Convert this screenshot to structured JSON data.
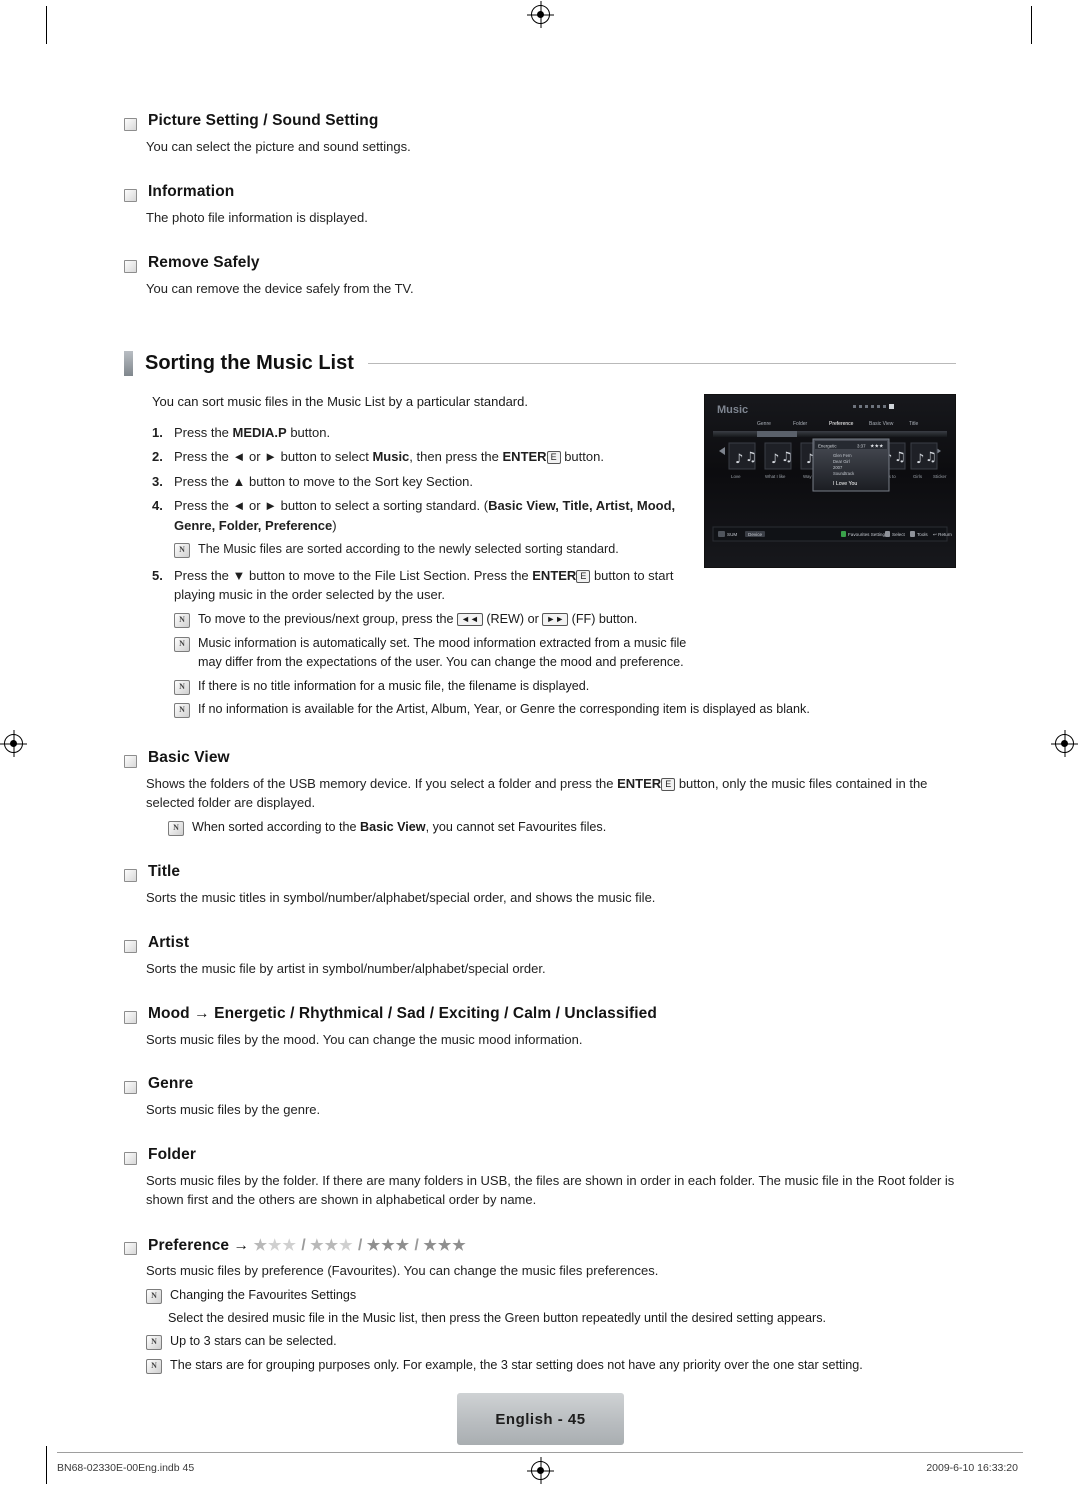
{
  "document": {
    "page_label": "English - 45",
    "footer_left": "BN68-02330E-00Eng.indb   45",
    "footer_right": "2009-6-10   16:33:20"
  },
  "top_sections": [
    {
      "title": "Picture Setting / Sound Setting",
      "body": "You can select the picture and sound settings."
    },
    {
      "title": "Information",
      "body": "The photo file information is displayed."
    },
    {
      "title": "Remove Safely",
      "body": "You can remove the device safely from the TV."
    }
  ],
  "section": {
    "heading": "Sorting the Music List",
    "intro": "You can sort music files in the Music List by a particular standard.",
    "steps": [
      {
        "num": "1.",
        "parts": [
          {
            "t": "Press the ",
            "b": false
          },
          {
            "t": "MEDIA.P",
            "b": true
          },
          {
            "t": " button.",
            "b": false
          }
        ]
      },
      {
        "num": "2.",
        "parts": [
          {
            "t": "Press the ◄ or ► button to select ",
            "b": false
          },
          {
            "t": "Music",
            "b": true
          },
          {
            "t": ", then press the ",
            "b": false
          },
          {
            "t": "ENTER",
            "b": true
          },
          {
            "t": "E",
            "b": false,
            "key": true
          },
          {
            "t": " button.",
            "b": false
          }
        ]
      },
      {
        "num": "3.",
        "parts": [
          {
            "t": "Press the ▲ button to move to the Sort key Section.",
            "b": false
          }
        ]
      },
      {
        "num": "4.",
        "parts": [
          {
            "t": "Press the ◄ or ► button to select a sorting standard. (",
            "b": false
          },
          {
            "t": "Basic View, Title, Artist, Mood, Genre, Folder, Preference",
            "b": true
          },
          {
            "t": ")",
            "b": false
          }
        ]
      },
      {
        "num": "5.",
        "parts": [
          {
            "t": "Press the ▼ button to move to the File List Section. Press the ",
            "b": false
          },
          {
            "t": "ENTER",
            "b": true
          },
          {
            "t": "E",
            "b": false,
            "key": true
          },
          {
            "t": " button to start playing music in the order selected by the user.",
            "b": false
          }
        ]
      }
    ],
    "note_after_step4": "The Music files are sorted according to the newly selected sorting standard.",
    "notes_after_step5": [
      "To move to the previous/next group, press the ◄◄ (REW) or ►► (FF) button.",
      "Music information is automatically set. The mood information extracted from a music file may differ from the expectations of the user. You can change the mood and preference.",
      "If there is no title information for a music file, the filename is displayed.",
      "If no information is available for the Artist, Album, Year, or Genre the corresponding item is displayed as blank."
    ]
  },
  "sort_options": [
    {
      "title": "Basic View",
      "body_parts": [
        {
          "t": "Shows the folders of the USB memory device. If you select a folder and press the ",
          "b": false
        },
        {
          "t": "ENTER",
          "b": true
        },
        {
          "t": "E",
          "b": false,
          "key": true
        },
        {
          "t": " button, only the music files contained in the selected folder are displayed.",
          "b": false
        }
      ],
      "note_parts": [
        {
          "t": "When sorted according to the ",
          "b": false
        },
        {
          "t": "Basic View",
          "b": true
        },
        {
          "t": ", you cannot set Favourites files.",
          "b": false
        }
      ]
    },
    {
      "title": "Title",
      "body": "Sorts the music titles in symbol/number/alphabet/special order, and shows the music file."
    },
    {
      "title": "Artist",
      "body": "Sorts the music file by artist in symbol/number/alphabet/special order."
    },
    {
      "title": "Mood → Energetic / Rhythmical / Sad / Exciting / Calm / Unclassified",
      "body": "Sorts music files by the mood. You can change the music mood information."
    },
    {
      "title": "Genre",
      "body": "Sorts music files by the genre."
    },
    {
      "title": "Folder",
      "body": "Sorts music files by the folder. If there are many folders in USB, the files are shown in order in each folder. The music file in the Root folder is shown first and the others are shown in alphabetical order by name."
    }
  ],
  "preference": {
    "title_prefix": "Preference →",
    "star_groups": [
      1,
      2,
      3,
      3
    ],
    "body": "Sorts music files by preference (Favourites). You can change the music files preferences.",
    "notes": [
      "Changing the Favourites Settings",
      "Up to 3 stars can be selected.",
      "The stars are for grouping purposes only. For example, the 3 star setting does not have any priority over the one star setting."
    ],
    "sub_note": "Select the desired music file in the Music list, then press the Green button repeatedly until the desired setting appears."
  },
  "tv_screenshot": {
    "app_title": "Music",
    "tabs": [
      "Genre",
      "Folder",
      "Preference",
      "Basic View",
      "Title"
    ],
    "now_playing": {
      "label": "Energetic",
      "time": "3:37",
      "title": "I Love You",
      "lines": [
        "Glen Fern",
        "Dear Girl",
        "2007",
        "Soundtrack"
      ]
    },
    "thumb_labels": [
      "Love",
      "What I like",
      "Way",
      "hurts to",
      "Girls",
      "Sticker"
    ],
    "footer_left": [
      "SUM",
      "Device"
    ],
    "footer_right": [
      "Favourites Setting",
      "Select",
      "Tools",
      "Return"
    ]
  }
}
